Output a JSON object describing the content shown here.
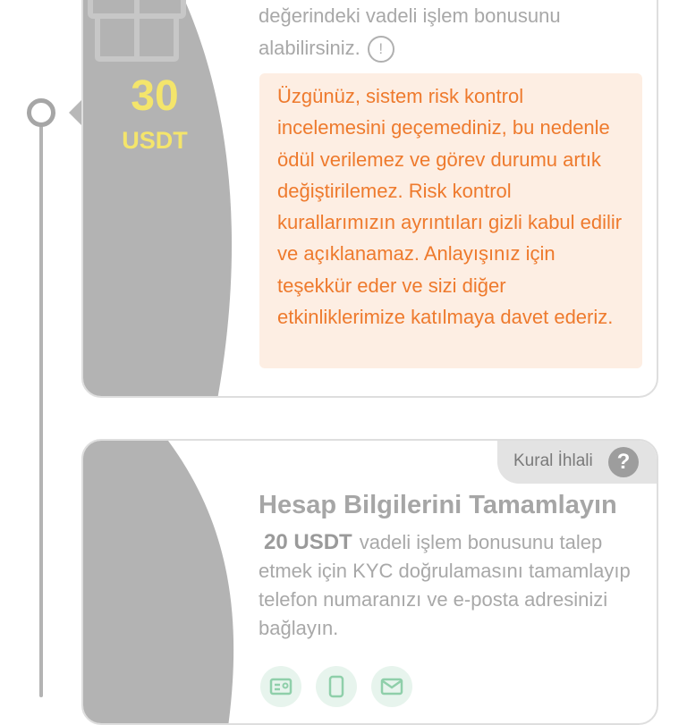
{
  "colors": {
    "panel_gray": "#b3b3b3",
    "reward_yellow": "#f4e56b",
    "notice_bg": "#fdeee3",
    "notice_text": "#ee7a2d",
    "muted_text": "#a8a8a8",
    "icon_green_bg": "#e7f4ed",
    "icon_green": "#8fcfaa"
  },
  "task1": {
    "reward_amount": "30",
    "reward_unit": "USDT",
    "description_line1": "değerindeki vadeli işlem bonusunu",
    "description_line2": "alabilirsiniz.",
    "info_icon_glyph": "!",
    "notice_text": "Üzgünüz, sistem risk kontrol incelemesini geçemediniz, bu nedenle ödül verilemez ve görev durumu artık değiştirilemez. Risk kontrol kurallarımızın ayrıntıları gizli kabul edilir ve açıklanamaz. Anlayışınız için teşekkür eder ve sizi diğer etkinliklerimize katılmaya davet ederiz."
  },
  "task2": {
    "rule_badge_label": "Kural İhlali",
    "help_icon_glyph": "?",
    "title": "Hesap Bilgilerini Tamamlayın",
    "reward_text": "20 USDT",
    "description": "vadeli işlem bonusunu talep etmek için KYC doğrulamasını tamamlayıp telefon numaranızı ve e-posta adresinizi bağlayın.",
    "icons": [
      "id-card-icon",
      "phone-icon",
      "email-icon"
    ]
  }
}
